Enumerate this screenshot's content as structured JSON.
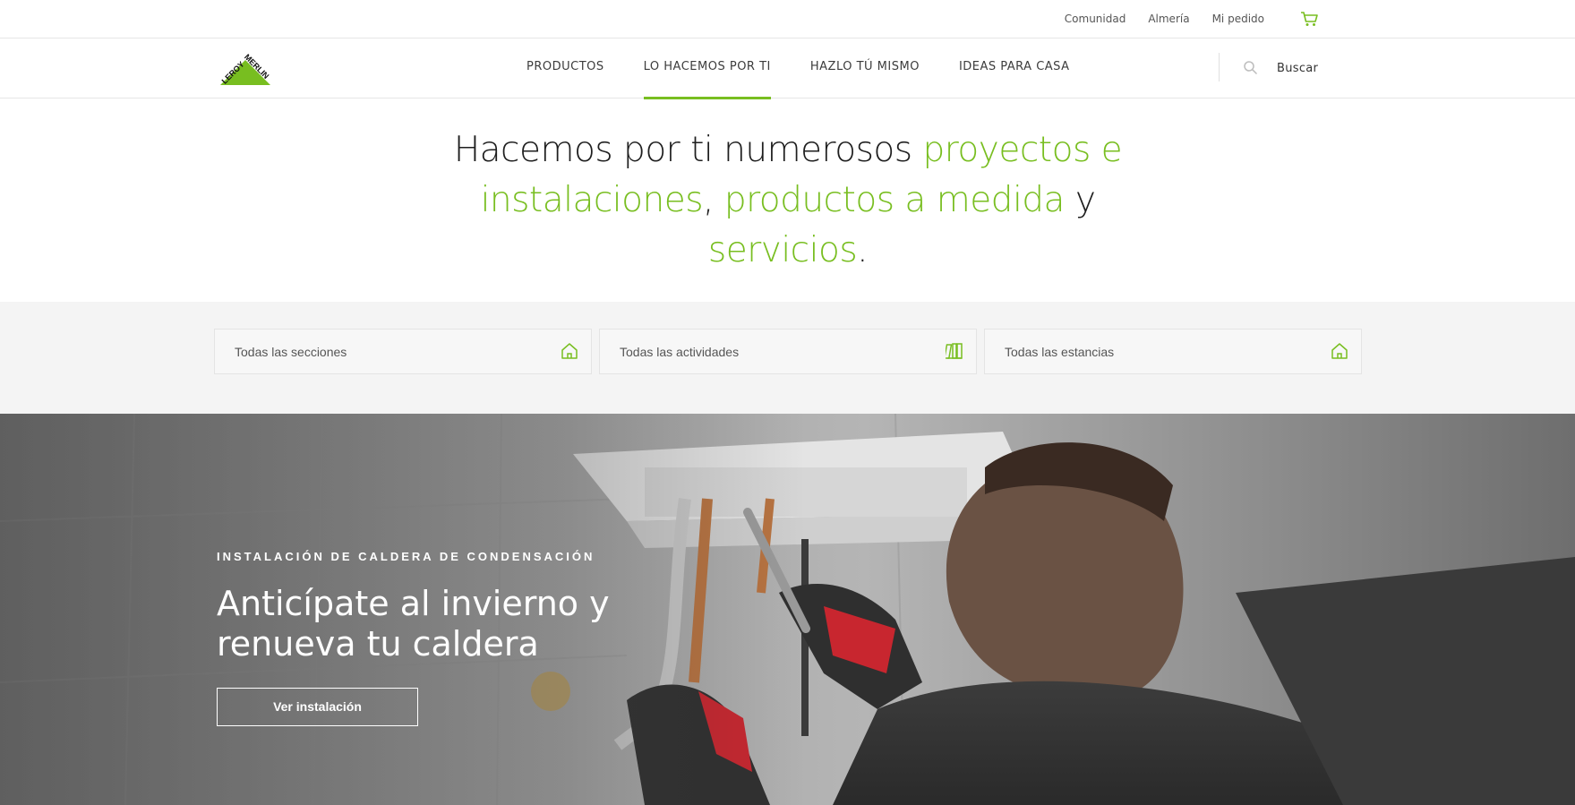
{
  "topbar": {
    "links": [
      "Comunidad",
      "Almería",
      "Mi pedido"
    ],
    "cart_icon": "cart-icon"
  },
  "brand": {
    "logo_text": "LEROY MERLIN",
    "accent_color": "#78be20"
  },
  "nav": {
    "items": [
      {
        "label": "PRODUCTOS",
        "active": false
      },
      {
        "label": "LO HACEMOS POR TI",
        "active": true
      },
      {
        "label": "HAZLO TÚ MISMO",
        "active": false
      },
      {
        "label": "IDEAS PARA CASA",
        "active": false
      }
    ],
    "search_label": "Buscar",
    "search_icon": "search-icon"
  },
  "headline": {
    "parts": [
      {
        "text": "Hacemos por ti numerosos ",
        "green": false
      },
      {
        "text": "proyectos e instalaciones",
        "green": true
      },
      {
        "text": ", ",
        "green": false
      },
      {
        "text": "productos a medida",
        "green": true
      },
      {
        "text": " y ",
        "green": false
      },
      {
        "text": "servicios",
        "green": true
      },
      {
        "text": ".",
        "green": false
      }
    ]
  },
  "filters": [
    {
      "label": "Todas las secciones",
      "icon": "house-icon"
    },
    {
      "label": "Todas las actividades",
      "icon": "tools-icon"
    },
    {
      "label": "Todas las estancias",
      "icon": "house-icon"
    }
  ],
  "hero": {
    "kicker": "INSTALACIÓN DE CALDERA DE CONDENSACIÓN",
    "title": "Anticípate al invierno y renueva tu caldera",
    "button_label": "Ver instalación"
  }
}
